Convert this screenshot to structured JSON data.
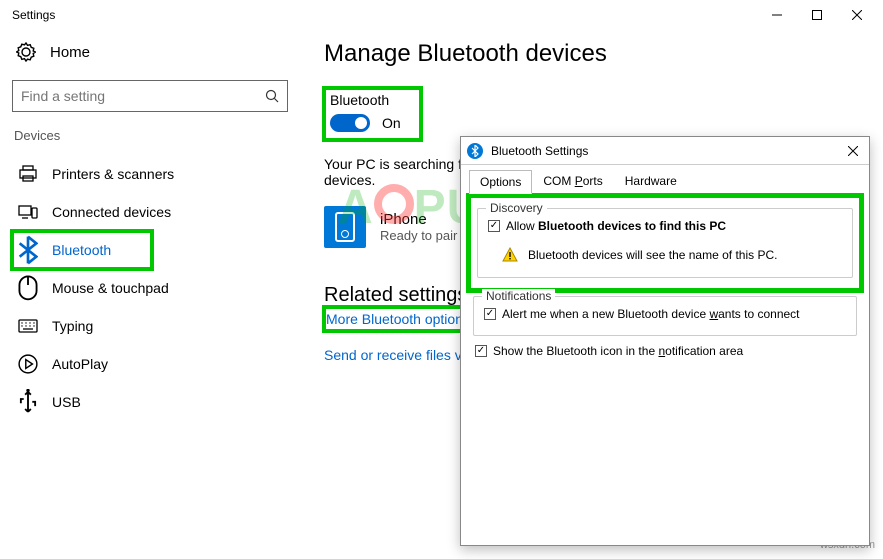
{
  "window": {
    "title": "Settings"
  },
  "nav": {
    "home": "Home",
    "search_placeholder": "Find a setting",
    "section": "Devices",
    "items": [
      {
        "label": "Printers & scanners"
      },
      {
        "label": "Connected devices"
      },
      {
        "label": "Bluetooth"
      },
      {
        "label": "Mouse & touchpad"
      },
      {
        "label": "Typing"
      },
      {
        "label": "AutoPlay"
      },
      {
        "label": "USB"
      }
    ]
  },
  "main": {
    "heading": "Manage Bluetooth devices",
    "bt_label": "Bluetooth",
    "bt_state": "On",
    "searching_line1": "Your PC is searching for and can be discovered by Bluetooth",
    "searching_line2": "devices.",
    "device_name": "iPhone",
    "device_sub": "Ready to pair",
    "related_heading": "Related settings",
    "link_more": "More Bluetooth options",
    "link_send": "Send or receive files via Bluetooth"
  },
  "dialog": {
    "title": "Bluetooth Settings",
    "tabs": {
      "options": "Options",
      "com": "COM Ports",
      "hardware": "Hardware"
    },
    "discovery": {
      "title": "Discovery",
      "allow_pre": "Allow ",
      "allow_bold": "Bluetooth devices to find this PC",
      "warn": "Bluetooth devices will see the name of this PC."
    },
    "notifications": {
      "title": "Notifications",
      "alert_pre": "Alert me when a new Bluetooth device ",
      "alert_u": "w",
      "alert_post": "ants to connect"
    },
    "tray_pre": "Show the Bluetooth icon in the ",
    "tray_u": "n",
    "tray_post": "otification area"
  },
  "watermark": {
    "site": "wsxdn.com",
    "brand": "APPUALS"
  }
}
